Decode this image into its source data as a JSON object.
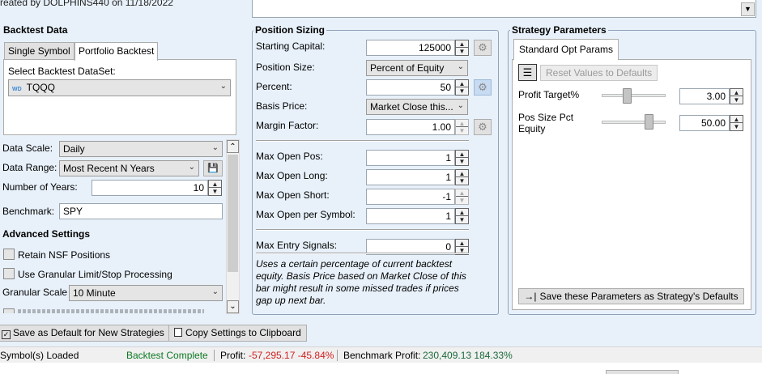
{
  "header": {
    "created_by_text": "reated by DOLPHINS440 on 11/18/2022"
  },
  "backtest_data": {
    "title": "Backtest Data",
    "tabs": [
      "Single Symbol",
      "Portfolio Backtest"
    ],
    "dataset_label": "Select Backtest DataSet:",
    "dataset_badge": "WD",
    "dataset_value": "TQQQ",
    "data_scale_label": "Data Scale:",
    "data_scale_value": "Daily",
    "data_range_label": "Data Range:",
    "data_range_value": "Most Recent N Years",
    "num_years_label": "Number of Years:",
    "num_years_value": "10",
    "benchmark_label": "Benchmark:",
    "benchmark_value": "SPY",
    "advanced_title": "Advanced Settings",
    "retain_nsf_label": "Retain NSF Positions",
    "granular_label": "Use Granular Limit/Stop Processing",
    "granular_scale_label": "Granular Scale",
    "granular_scale_value": "10 Minute"
  },
  "position_sizing": {
    "title": "Position Sizing",
    "starting_capital_label": "Starting Capital:",
    "starting_capital_value": "125000",
    "position_size_label": "Position Size:",
    "position_size_value": "Percent of Equity",
    "percent_label": "Percent:",
    "percent_value": "50",
    "basis_price_label": "Basis Price:",
    "basis_price_value": "Market Close this...",
    "margin_factor_label": "Margin Factor:",
    "margin_factor_value": "1.00",
    "max_open_pos_label": "Max Open Pos:",
    "max_open_pos_value": "1",
    "max_open_long_label": "Max Open Long:",
    "max_open_long_value": "1",
    "max_open_short_label": "Max Open Short:",
    "max_open_short_value": "-1",
    "max_open_per_symbol_label": "Max Open per Symbol:",
    "max_open_per_symbol_value": "1",
    "max_entry_signals_label": "Max Entry Signals:",
    "max_entry_signals_value": "0",
    "description": "Uses a certain percentage of current backtest equity. Basis Price based on Market Close of this bar might result in some missed trades if prices gap up next bar."
  },
  "strategy_parameters": {
    "title": "Strategy Parameters",
    "tab_label": "Standard Opt Params",
    "reset_label": "Reset Values to Defaults",
    "profit_target_label": "Profit Target%",
    "profit_target_value": "3.00",
    "profit_target_level": 0.4,
    "pos_size_label_1": "Pos Size Pct",
    "pos_size_label_2": "Equity",
    "pos_size_value": "50.00",
    "pos_size_level": 0.7,
    "save_params_label": "Save these Parameters as Strategy's Defaults"
  },
  "bottom": {
    "save_default_label": "Save as Default for New Strategies",
    "copy_settings_label": "Copy Settings to Clipboard"
  },
  "status": {
    "symbols_loaded": "Symbol(s) Loaded",
    "backtest_complete": "Backtest Complete",
    "profit_label": "Profit:",
    "profit_value": "-57,295.17 -45.84%",
    "benchmark_label": "Benchmark Profit:",
    "benchmark_value": "230,409.13 184.33%"
  },
  "colors": {
    "accent": "#0b7a22",
    "negative": "#d42020",
    "benchmark": "#1a6a3a",
    "background": "#e8f1fa"
  }
}
